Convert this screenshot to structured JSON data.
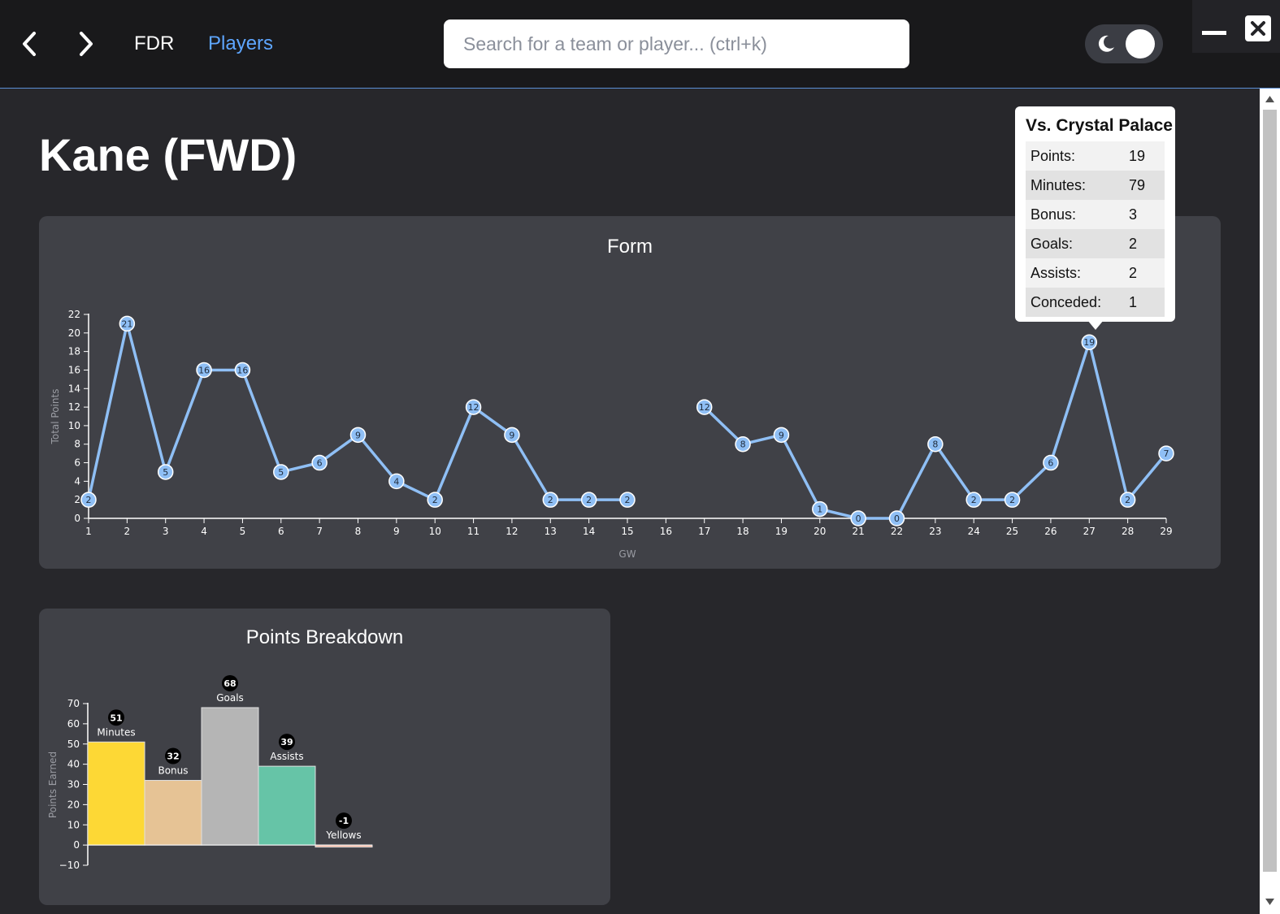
{
  "nav": {
    "fdr_label": "FDR",
    "players_label": "Players",
    "search_placeholder": "Search for a team or player... (ctrl+k)"
  },
  "page": {
    "title": "Kane (FWD)"
  },
  "colors": {
    "accent": "#5ea6ff",
    "form_line": "#8fbff5",
    "card_bg": "#404147",
    "page_bg": "#27272b"
  },
  "form_card": {
    "title": "Form"
  },
  "breakdown_card": {
    "title": "Points Breakdown"
  },
  "tooltip": {
    "title": "Vs. Crystal Palace",
    "rows": [
      {
        "label": "Points:",
        "value": "19"
      },
      {
        "label": "Minutes:",
        "value": "79"
      },
      {
        "label": "Bonus:",
        "value": "3"
      },
      {
        "label": "Goals:",
        "value": "2"
      },
      {
        "label": "Assists:",
        "value": "2"
      },
      {
        "label": "Conceded:",
        "value": "1"
      }
    ]
  },
  "chart_data": [
    {
      "type": "line",
      "title": "Form",
      "xlabel": "GW",
      "ylabel": "Total Points",
      "ylim": [
        0,
        22
      ],
      "yticks": [
        0,
        2,
        4,
        6,
        8,
        10,
        12,
        14,
        16,
        18,
        20,
        22
      ],
      "x": [
        1,
        2,
        3,
        4,
        5,
        6,
        7,
        8,
        9,
        10,
        11,
        12,
        13,
        14,
        15,
        16,
        17,
        18,
        19,
        20,
        21,
        22,
        23,
        24,
        25,
        26,
        27,
        28,
        29
      ],
      "series": [
        {
          "values": [
            2,
            21,
            5,
            16,
            16,
            5,
            6,
            9,
            4,
            2,
            12,
            9,
            2,
            2,
            2,
            null,
            12,
            8,
            9,
            1,
            0,
            0,
            8,
            2,
            2,
            6,
            19,
            2,
            7
          ]
        }
      ],
      "grid": false
    },
    {
      "type": "bar",
      "title": "Points Breakdown",
      "ylabel": "Points Earned",
      "ylim": [
        -10,
        70
      ],
      "yticks": [
        -10,
        0,
        10,
        20,
        30,
        40,
        50,
        60,
        70
      ],
      "categories": [
        "Minutes",
        "Bonus",
        "Goals",
        "Assists",
        "Yellows"
      ],
      "values": [
        51,
        32,
        68,
        39,
        -1
      ],
      "colors": [
        "#fdd835",
        "#e6c395",
        "#b5b5b5",
        "#66c4a7",
        "#f3b19a"
      ],
      "grid": false
    }
  ]
}
